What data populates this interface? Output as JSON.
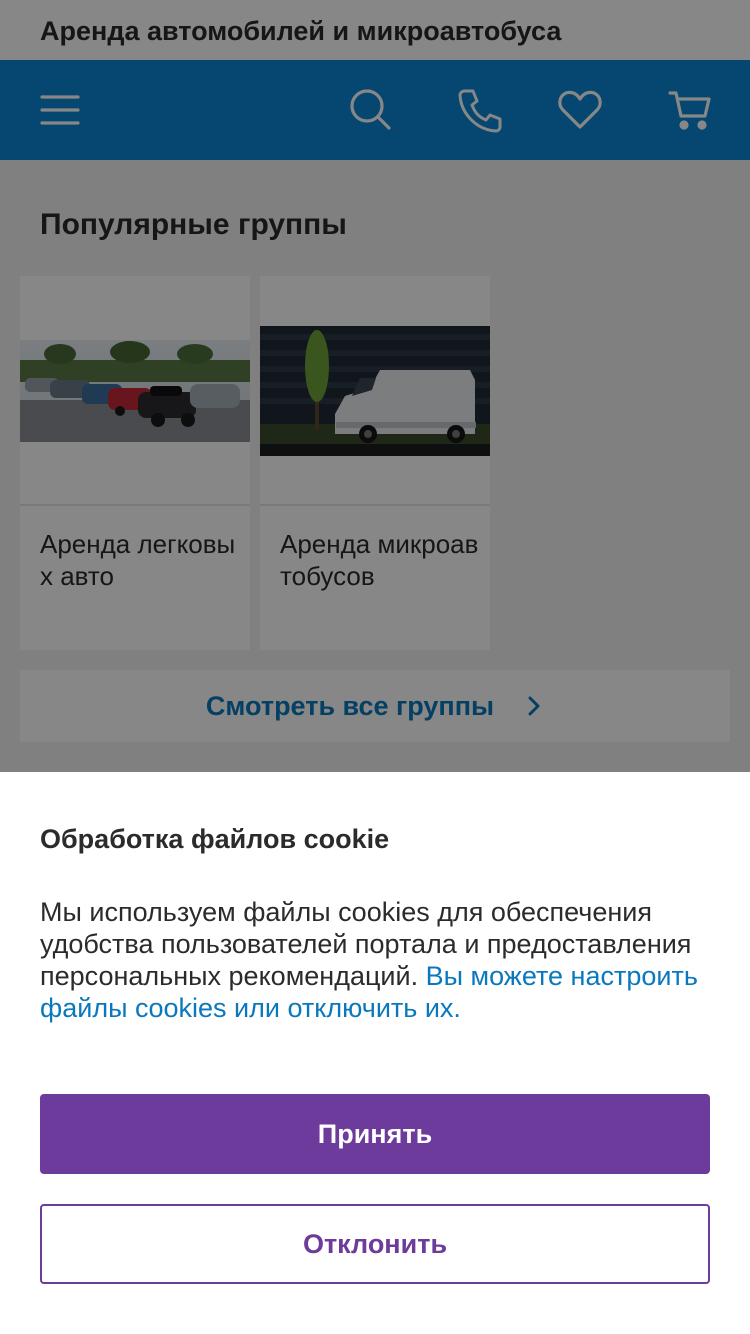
{
  "header": {
    "title": "Аренда автомобилей и микроавтобуса"
  },
  "nav": {
    "icons": [
      "menu-icon",
      "search-icon",
      "phone-icon",
      "heart-icon",
      "cart-icon"
    ],
    "background_color": "#0a87d3",
    "icon_color": "#ffffff"
  },
  "main": {
    "section_title": "Популярные группы",
    "cards": [
      {
        "label": "Аренда легковых авто",
        "image": "cars-parking-photo"
      },
      {
        "label": "Аренда микроавтобусов",
        "image": "white-van-photo"
      }
    ],
    "all_groups_label": "Смотреть все группы",
    "all_groups_icon": "chevron-right-icon",
    "link_color": "#0a78bd"
  },
  "cookie_banner": {
    "title": "Обработка файлов cookie",
    "text": "Мы используем файлы cookies для обеспечения удобства пользователей портала и предоставления персональных рекомендаций.",
    "link_text": "Вы можете настроить файлы cookies или отключить их.",
    "accept_label": "Принять",
    "decline_label": "Отклонить",
    "accent_color": "#6d3b9b"
  }
}
